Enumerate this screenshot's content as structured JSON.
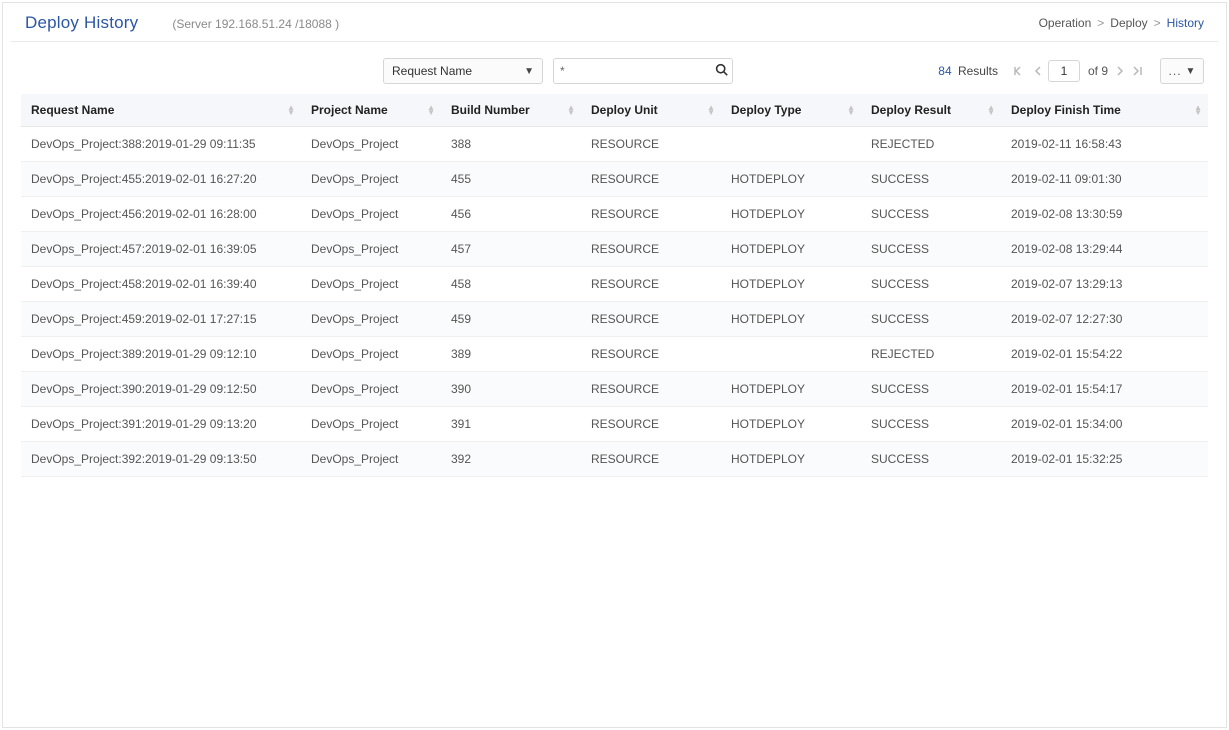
{
  "header": {
    "title": "Deploy History",
    "server_info": "(Server 192.168.51.24 /18088 )"
  },
  "breadcrumb": {
    "operation": "Operation",
    "deploy": "Deploy",
    "history": "History"
  },
  "toolbar": {
    "filter_field": "Request Name",
    "search_value": "*",
    "results_count": "84",
    "results_label": "Results",
    "page_current": "1",
    "page_total_label": "of 9",
    "more_label": "..."
  },
  "columns": [
    "Request Name",
    "Project Name",
    "Build Number",
    "Deploy Unit",
    "Deploy Type",
    "Deploy Result",
    "Deploy Finish Time"
  ],
  "col_widths": [
    "280px",
    "140px",
    "140px",
    "140px",
    "140px",
    "140px",
    ""
  ],
  "rows": [
    {
      "request": "DevOps_Project:388:2019-01-29 09:11:35",
      "project": "DevOps_Project",
      "build": "388",
      "unit": "RESOURCE",
      "type": "",
      "result": "REJECTED",
      "finish": "2019-02-11 16:58:43"
    },
    {
      "request": "DevOps_Project:455:2019-02-01 16:27:20",
      "project": "DevOps_Project",
      "build": "455",
      "unit": "RESOURCE",
      "type": "HOTDEPLOY",
      "result": "SUCCESS",
      "finish": "2019-02-11 09:01:30"
    },
    {
      "request": "DevOps_Project:456:2019-02-01 16:28:00",
      "project": "DevOps_Project",
      "build": "456",
      "unit": "RESOURCE",
      "type": "HOTDEPLOY",
      "result": "SUCCESS",
      "finish": "2019-02-08 13:30:59"
    },
    {
      "request": "DevOps_Project:457:2019-02-01 16:39:05",
      "project": "DevOps_Project",
      "build": "457",
      "unit": "RESOURCE",
      "type": "HOTDEPLOY",
      "result": "SUCCESS",
      "finish": "2019-02-08 13:29:44"
    },
    {
      "request": "DevOps_Project:458:2019-02-01 16:39:40",
      "project": "DevOps_Project",
      "build": "458",
      "unit": "RESOURCE",
      "type": "HOTDEPLOY",
      "result": "SUCCESS",
      "finish": "2019-02-07 13:29:13"
    },
    {
      "request": "DevOps_Project:459:2019-02-01 17:27:15",
      "project": "DevOps_Project",
      "build": "459",
      "unit": "RESOURCE",
      "type": "HOTDEPLOY",
      "result": "SUCCESS",
      "finish": "2019-02-07 12:27:30"
    },
    {
      "request": "DevOps_Project:389:2019-01-29 09:12:10",
      "project": "DevOps_Project",
      "build": "389",
      "unit": "RESOURCE",
      "type": "",
      "result": "REJECTED",
      "finish": "2019-02-01 15:54:22"
    },
    {
      "request": "DevOps_Project:390:2019-01-29 09:12:50",
      "project": "DevOps_Project",
      "build": "390",
      "unit": "RESOURCE",
      "type": "HOTDEPLOY",
      "result": "SUCCESS",
      "finish": "2019-02-01 15:54:17"
    },
    {
      "request": "DevOps_Project:391:2019-01-29 09:13:20",
      "project": "DevOps_Project",
      "build": "391",
      "unit": "RESOURCE",
      "type": "HOTDEPLOY",
      "result": "SUCCESS",
      "finish": "2019-02-01 15:34:00"
    },
    {
      "request": "DevOps_Project:392:2019-01-29 09:13:50",
      "project": "DevOps_Project",
      "build": "392",
      "unit": "RESOURCE",
      "type": "HOTDEPLOY",
      "result": "SUCCESS",
      "finish": "2019-02-01 15:32:25"
    }
  ]
}
